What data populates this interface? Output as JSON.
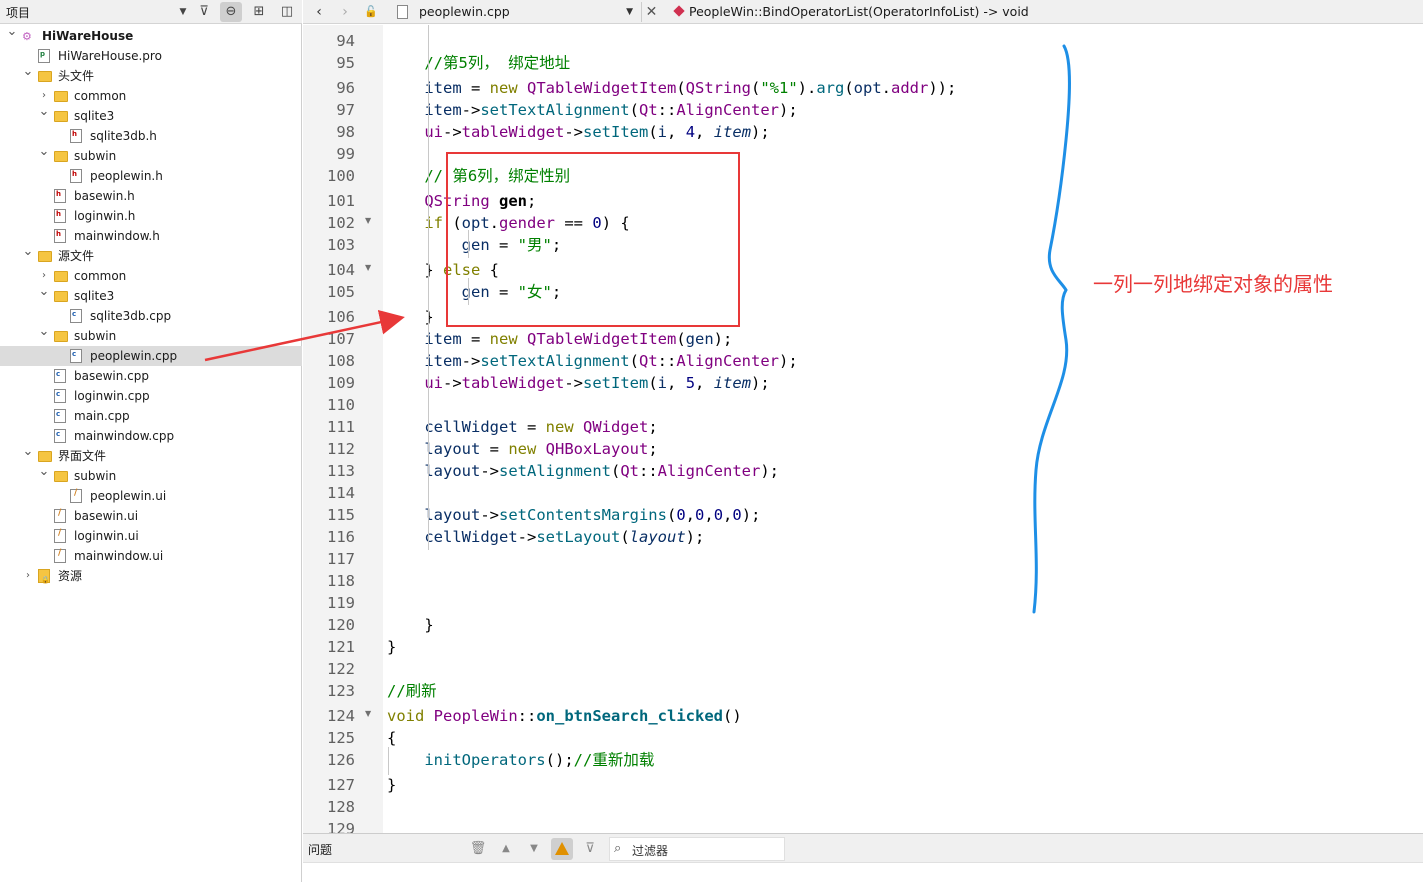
{
  "left_panel": {
    "title": "项目",
    "tree": [
      {
        "label": "HiWareHouse",
        "depth": 0,
        "expanded": true,
        "icon": "project-icon",
        "bold": true
      },
      {
        "label": "HiWareHouse.pro",
        "depth": 1,
        "icon": "pro-file-icon"
      },
      {
        "label": "头文件",
        "depth": 1,
        "expanded": true,
        "icon": "header-folder-icon"
      },
      {
        "label": "common",
        "depth": 2,
        "expanded": false,
        "icon": "folder-icon"
      },
      {
        "label": "sqlite3",
        "depth": 2,
        "expanded": true,
        "icon": "folder-icon"
      },
      {
        "label": "sqlite3db.h",
        "depth": 3,
        "icon": "header-file-icon"
      },
      {
        "label": "subwin",
        "depth": 2,
        "expanded": true,
        "icon": "folder-icon"
      },
      {
        "label": "peoplewin.h",
        "depth": 3,
        "icon": "header-file-icon"
      },
      {
        "label": "basewin.h",
        "depth": 2,
        "icon": "header-file-icon"
      },
      {
        "label": "loginwin.h",
        "depth": 2,
        "icon": "header-file-icon"
      },
      {
        "label": "mainwindow.h",
        "depth": 2,
        "icon": "header-file-icon"
      },
      {
        "label": "源文件",
        "depth": 1,
        "expanded": true,
        "icon": "source-folder-icon"
      },
      {
        "label": "common",
        "depth": 2,
        "expanded": false,
        "icon": "folder-icon"
      },
      {
        "label": "sqlite3",
        "depth": 2,
        "expanded": true,
        "icon": "folder-icon"
      },
      {
        "label": "sqlite3db.cpp",
        "depth": 3,
        "icon": "cpp-file-icon"
      },
      {
        "label": "subwin",
        "depth": 2,
        "expanded": true,
        "icon": "folder-icon"
      },
      {
        "label": "peoplewin.cpp",
        "depth": 3,
        "icon": "cpp-file-icon",
        "selected": true
      },
      {
        "label": "basewin.cpp",
        "depth": 2,
        "icon": "cpp-file-icon"
      },
      {
        "label": "loginwin.cpp",
        "depth": 2,
        "icon": "cpp-file-icon"
      },
      {
        "label": "main.cpp",
        "depth": 2,
        "icon": "cpp-file-icon"
      },
      {
        "label": "mainwindow.cpp",
        "depth": 2,
        "icon": "cpp-file-icon"
      },
      {
        "label": "界面文件",
        "depth": 1,
        "expanded": true,
        "icon": "forms-folder-icon"
      },
      {
        "label": "subwin",
        "depth": 2,
        "expanded": true,
        "icon": "folder-icon"
      },
      {
        "label": "peoplewin.ui",
        "depth": 3,
        "icon": "ui-file-icon"
      },
      {
        "label": "basewin.ui",
        "depth": 2,
        "icon": "ui-file-icon"
      },
      {
        "label": "loginwin.ui",
        "depth": 2,
        "icon": "ui-file-icon"
      },
      {
        "label": "mainwindow.ui",
        "depth": 2,
        "icon": "ui-file-icon"
      },
      {
        "label": "资源",
        "depth": 1,
        "expanded": false,
        "icon": "resources-folder-icon"
      }
    ]
  },
  "editor": {
    "file_name": "peoplewin.cpp",
    "function_signature": "PeopleWin::BindOperatorList(OperatorInfoList) -> void",
    "lines": [
      {
        "n": "94",
        "fold": false,
        "html": ""
      },
      {
        "n": "95",
        "fold": false,
        "html": "    <span class=\"cm\">//第5列， 绑定地址</span>"
      },
      {
        "n": "96",
        "fold": false,
        "html": "    <span class=\"pm\">item</span> = <span class=\"kw\">new</span> <span class=\"ty\">QTableWidgetItem</span>(<span class=\"ty\">QString</span>(<span class=\"st\">\"%1\"</span>).<span class=\"fn\">arg</span>(<span class=\"pm\">opt</span>.<span class=\"ty\">addr</span>));"
      },
      {
        "n": "97",
        "fold": false,
        "html": "    <span class=\"pm\">item</span>-><span class=\"fn\">setTextAlignment</span>(<span class=\"ty\">Qt</span>::<span class=\"ty\">AlignCenter</span>);"
      },
      {
        "n": "98",
        "fold": false,
        "html": "    <span class=\"ty\">ui</span>-><span class=\"ty\">tableWidget</span>-><span class=\"fn\">setItem</span>(<span class=\"pm\">i</span>, <span class=\"nm\">4</span>, <span class=\"it\">item</span>);"
      },
      {
        "n": "99",
        "fold": false,
        "html": ""
      },
      {
        "n": "100",
        "fold": false,
        "html": "    <span class=\"cm\">// 第6列，绑定性别</span>"
      },
      {
        "n": "101",
        "fold": false,
        "html": "    <span class=\"ty\">QString</span> <span class=\"bl\">gen</span>;"
      },
      {
        "n": "102",
        "fold": true,
        "html": "    <span class=\"kw\">if</span> (<span class=\"pm\">opt</span>.<span class=\"ty\">gender</span> == <span class=\"nm\">0</span>) {"
      },
      {
        "n": "103",
        "fold": false,
        "html": "        <span class=\"pm\">gen</span> = <span class=\"st\">\"男\"</span>;"
      },
      {
        "n": "104",
        "fold": true,
        "html": "    } <span class=\"kw\">else</span> {"
      },
      {
        "n": "105",
        "fold": false,
        "html": "        <span class=\"pm\">gen</span> = <span class=\"st\">\"女\"</span>;"
      },
      {
        "n": "106",
        "fold": false,
        "html": "    }"
      },
      {
        "n": "107",
        "fold": false,
        "html": "    <span class=\"pm\">item</span> = <span class=\"kw\">new</span> <span class=\"ty\">QTableWidgetItem</span>(<span class=\"pm\">gen</span>);"
      },
      {
        "n": "108",
        "fold": false,
        "html": "    <span class=\"pm\">item</span>-><span class=\"fn\">setTextAlignment</span>(<span class=\"ty\">Qt</span>::<span class=\"ty\">AlignCenter</span>);"
      },
      {
        "n": "109",
        "fold": false,
        "html": "    <span class=\"ty\">ui</span>-><span class=\"ty\">tableWidget</span>-><span class=\"fn\">setItem</span>(<span class=\"pm\">i</span>, <span class=\"nm\">5</span>, <span class=\"it\">item</span>);"
      },
      {
        "n": "110",
        "fold": false,
        "html": ""
      },
      {
        "n": "111",
        "fold": false,
        "html": "    <span class=\"pm\">cellWidget</span> = <span class=\"kw\">new</span> <span class=\"ty\">QWidget</span>;"
      },
      {
        "n": "112",
        "fold": false,
        "html": "    <span class=\"pm\">layout</span> = <span class=\"kw\">new</span> <span class=\"ty\">QHBoxLayout</span>;"
      },
      {
        "n": "113",
        "fold": false,
        "html": "    <span class=\"pm\">layout</span>-><span class=\"fn\">setAlignment</span>(<span class=\"ty\">Qt</span>::<span class=\"ty\">AlignCenter</span>);"
      },
      {
        "n": "114",
        "fold": false,
        "html": ""
      },
      {
        "n": "115",
        "fold": false,
        "html": "    <span class=\"pm\">layout</span>-><span class=\"fn\">setContentsMargins</span>(<span class=\"nm\">0</span>,<span class=\"nm\">0</span>,<span class=\"nm\">0</span>,<span class=\"nm\">0</span>);"
      },
      {
        "n": "116",
        "fold": false,
        "html": "    <span class=\"pm\">cellWidget</span>-><span class=\"fn\">setLayout</span>(<span class=\"it\">layout</span>);"
      },
      {
        "n": "117",
        "fold": false,
        "html": ""
      },
      {
        "n": "118",
        "fold": false,
        "html": ""
      },
      {
        "n": "119",
        "fold": false,
        "html": ""
      },
      {
        "n": "120",
        "fold": false,
        "html": "    }"
      },
      {
        "n": "121",
        "fold": false,
        "html": "}"
      },
      {
        "n": "122",
        "fold": false,
        "html": ""
      },
      {
        "n": "123",
        "fold": false,
        "html": "<span class=\"cm\">//刷新</span>"
      },
      {
        "n": "124",
        "fold": true,
        "html": "<span class=\"kw\">void</span> <span class=\"ty\">PeopleWin</span>::<span class=\"bd\">on_btnSearch_clicked</span>()"
      },
      {
        "n": "125",
        "fold": false,
        "html": "{"
      },
      {
        "n": "126",
        "fold": false,
        "html": "    <span class=\"fn\">initOperators</span>();<span class=\"cm\">//重新加载</span>"
      },
      {
        "n": "127",
        "fold": false,
        "html": "}"
      },
      {
        "n": "128",
        "fold": false,
        "html": ""
      },
      {
        "n": "129",
        "fold": false,
        "html": ""
      }
    ]
  },
  "annotation": {
    "text": "一列一列地绑定对象的属性",
    "color": "#e83838",
    "brace_color": "#1e8fe6"
  },
  "issues_bar": {
    "label": "问题",
    "filter_placeholder": "过滤器"
  },
  "colors": {
    "accent": "#e83838",
    "selection": "#dcdcdc"
  }
}
